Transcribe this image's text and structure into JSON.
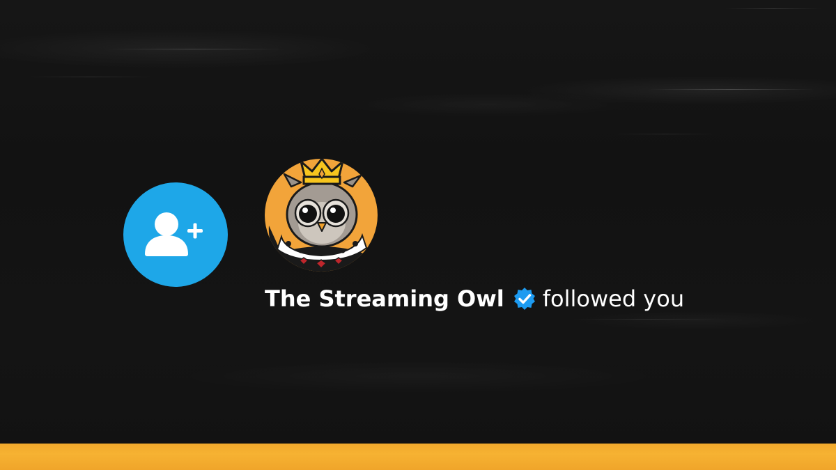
{
  "notification": {
    "display_name": "The Streaming Owl",
    "action": "followed you",
    "verified": true,
    "icon": "add-user-icon",
    "avatar": "crowned-owl-avatar",
    "verified_icon": "verified-badge-icon"
  },
  "colors": {
    "background": "#141414",
    "badge": "#1ea7e8",
    "accent_bar": "#f4ad2f",
    "avatar_background": "#f2a43a",
    "text": "#ffffff",
    "verified": "#1d9bf0"
  }
}
